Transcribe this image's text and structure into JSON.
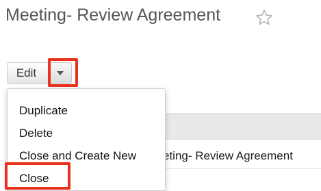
{
  "title": {
    "text": "Meeting- Review Agreement"
  },
  "icons": {
    "favorite": "star-outline-icon",
    "dropdown": "caret-down-icon"
  },
  "actions": {
    "edit_label": "Edit"
  },
  "menu": {
    "items": [
      {
        "label": "Duplicate"
      },
      {
        "label": "Delete"
      },
      {
        "label": "Close and Create New"
      },
      {
        "label": "Close"
      }
    ]
  },
  "record": {
    "name_fragment": "eting- Review Agreement"
  },
  "colors": {
    "highlight": "#e8321e",
    "title_text": "#555555",
    "header_strip": "#e9e9e9"
  }
}
